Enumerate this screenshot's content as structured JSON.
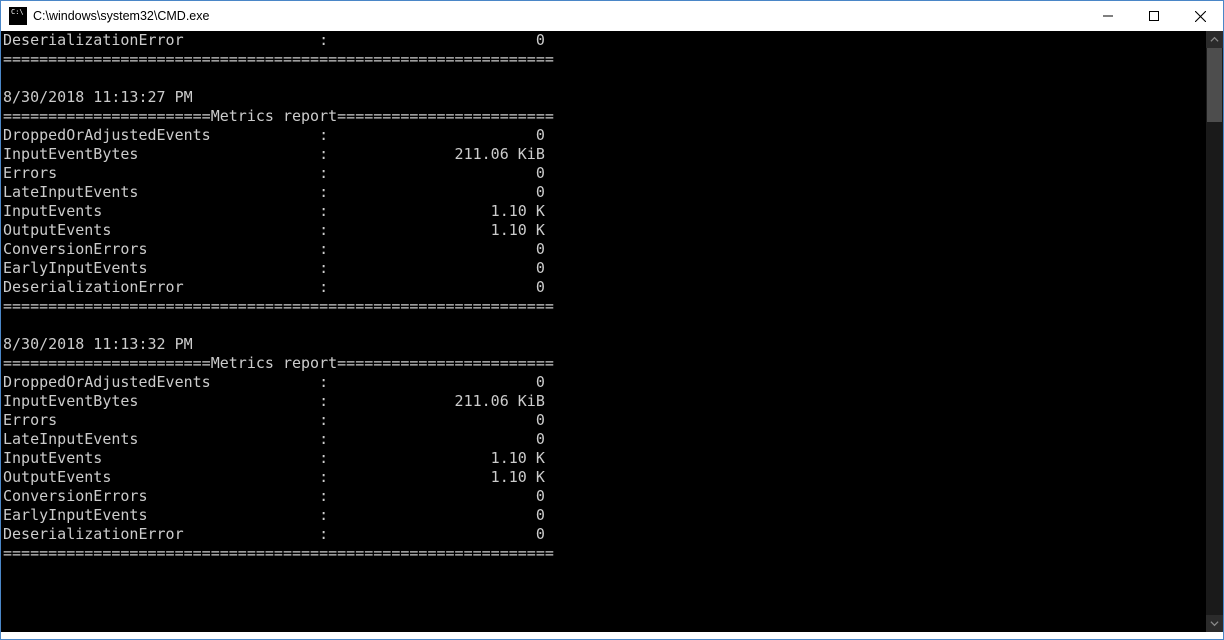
{
  "window": {
    "title": "C:\\windows\\system32\\CMD.exe"
  },
  "console": {
    "label_width": 35,
    "value_width": 24,
    "section_header": "Metrics report",
    "rule_char": "=",
    "rule_total_width": 61,
    "top_partial": {
      "metrics": [
        {
          "name": "DeserializationError",
          "value": "0"
        }
      ]
    },
    "reports": [
      {
        "timestamp": "8/30/2018 11:13:27 PM",
        "metrics": [
          {
            "name": "DroppedOrAdjustedEvents",
            "value": "0"
          },
          {
            "name": "InputEventBytes",
            "value": "211.06 KiB"
          },
          {
            "name": "Errors",
            "value": "0"
          },
          {
            "name": "LateInputEvents",
            "value": "0"
          },
          {
            "name": "InputEvents",
            "value": "1.10 K"
          },
          {
            "name": "OutputEvents",
            "value": "1.10 K"
          },
          {
            "name": "ConversionErrors",
            "value": "0"
          },
          {
            "name": "EarlyInputEvents",
            "value": "0"
          },
          {
            "name": "DeserializationError",
            "value": "0"
          }
        ]
      },
      {
        "timestamp": "8/30/2018 11:13:32 PM",
        "metrics": [
          {
            "name": "DroppedOrAdjustedEvents",
            "value": "0"
          },
          {
            "name": "InputEventBytes",
            "value": "211.06 KiB"
          },
          {
            "name": "Errors",
            "value": "0"
          },
          {
            "name": "LateInputEvents",
            "value": "0"
          },
          {
            "name": "InputEvents",
            "value": "1.10 K"
          },
          {
            "name": "OutputEvents",
            "value": "1.10 K"
          },
          {
            "name": "ConversionErrors",
            "value": "0"
          },
          {
            "name": "EarlyInputEvents",
            "value": "0"
          },
          {
            "name": "DeserializationError",
            "value": "0"
          }
        ]
      }
    ]
  }
}
